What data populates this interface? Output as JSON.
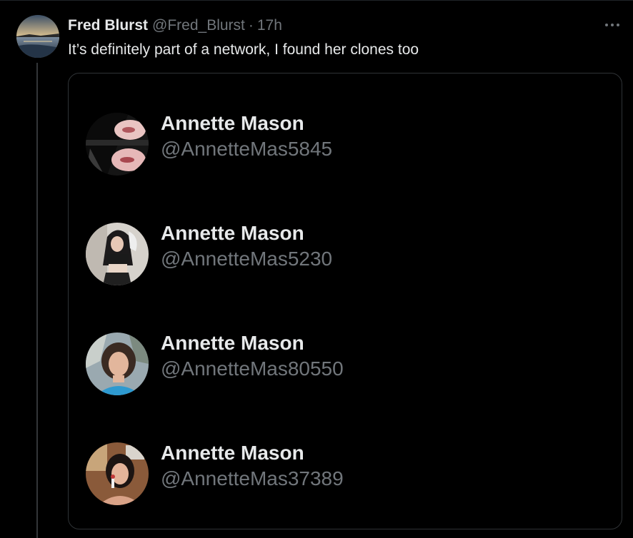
{
  "tweet": {
    "author_name": "Fred Blurst",
    "author_handle": "@Fred_Blurst",
    "separator": "·",
    "time": "17h",
    "text": "It’s definitely part of a network, I found her clones too",
    "more_icon": "more-horizontal-icon"
  },
  "media": {
    "accounts": [
      {
        "name": "Annette Mason",
        "handle": "@AnnetteMas5845"
      },
      {
        "name": "Annette Mason",
        "handle": "@AnnetteMas5230"
      },
      {
        "name": "Annette Mason",
        "handle": "@AnnetteMas80550"
      },
      {
        "name": "Annette Mason",
        "handle": "@AnnetteMas37389"
      }
    ]
  },
  "colors": {
    "background": "#000000",
    "primary_text": "#e7e9ea",
    "secondary_text": "#71767b",
    "border": "#2f3336"
  }
}
